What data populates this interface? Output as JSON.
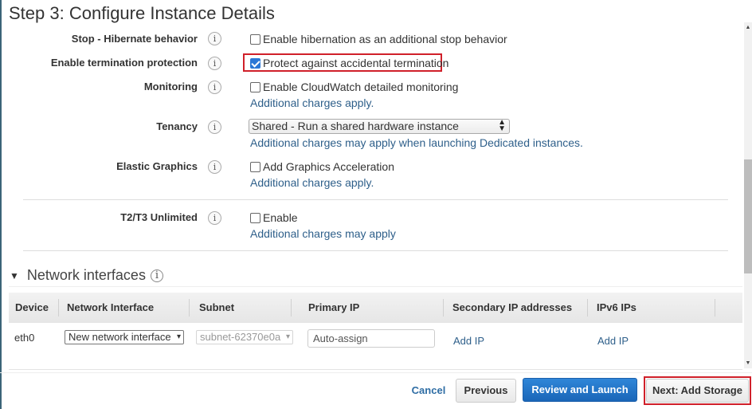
{
  "page": {
    "title": "Step 3: Configure Instance Details"
  },
  "settings": [
    {
      "label": "Stop - Hibernate behavior",
      "option": "Enable hibernation as an additional stop behavior",
      "checked": false
    },
    {
      "label": "Enable termination protection",
      "option": "Protect against accidental termination",
      "checked": true
    },
    {
      "label": "Monitoring",
      "option": "Enable CloudWatch detailed monitoring",
      "checked": false,
      "note": "Additional charges apply."
    },
    {
      "label": "Tenancy",
      "select_value": "Shared - Run a shared hardware instance",
      "note": "Additional charges may apply when launching Dedicated instances."
    },
    {
      "label": "Elastic Graphics",
      "option": "Add Graphics Acceleration",
      "checked": false,
      "note": "Additional charges apply."
    },
    {
      "label": "T2/T3 Unlimited",
      "option": "Enable",
      "checked": false,
      "note": "Additional charges may apply"
    }
  ],
  "info_glyph": "i",
  "network": {
    "section_title": "Network interfaces",
    "caret": "▼",
    "columns": [
      "Device",
      "Network Interface",
      "Subnet",
      "Primary IP",
      "Secondary IP addresses",
      "IPv6 IPs"
    ],
    "rows": [
      {
        "device": "eth0",
        "network_interface": "New network interface",
        "subnet": "subnet-62370e0a",
        "primary_ip_placeholder": "Auto-assign",
        "secondary_ip_link": "Add IP",
        "ipv6_link": "Add IP"
      }
    ]
  },
  "footer": {
    "cancel": "Cancel",
    "previous": "Previous",
    "review_launch": "Review and Launch",
    "next": "Next: Add Storage"
  },
  "colors": {
    "primary_button": "#1a66b8",
    "highlight_border": "#d0202a",
    "link": "#2e5f8a"
  }
}
